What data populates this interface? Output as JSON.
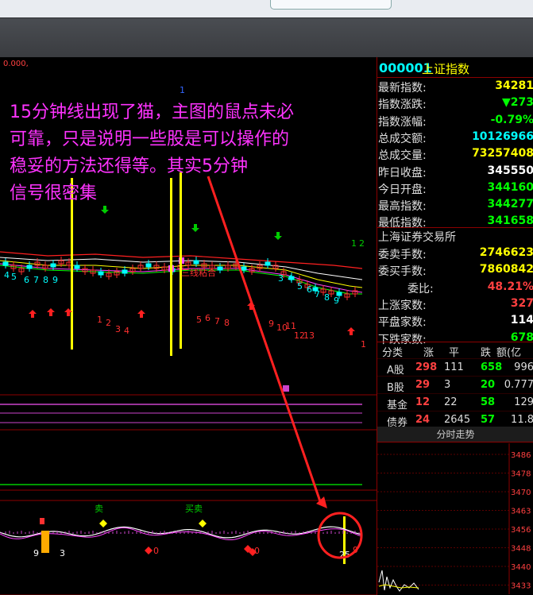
{
  "annotation": "15分钟线出现了猫，主图的鼠点未必可靠，只是说明一些股是可以操作的稳妥的方法还得等。其实5分钟信号很密集",
  "annotation_lines": [
    "15分钟线出现了猫，主图的鼠点未必",
    "可靠，只是说明一些股是可以操作的",
    "稳妥的方法还得等。其实5分钟",
    "信号很密集"
  ],
  "chart_corner_label": "0.000,",
  "quote": {
    "code": "000001",
    "name": "上证指数",
    "rows": [
      {
        "label": "最新指数:",
        "value": "34281",
        "color": "#ffff00"
      },
      {
        "label": "指数涨跌:",
        "value": "▼273",
        "color": "#00ff00"
      },
      {
        "label": "指数涨幅:",
        "value": "-0.79%",
        "color": "#00ff00"
      },
      {
        "label": "总成交额:",
        "value": "10126966",
        "color": "#00ffff"
      },
      {
        "label": "总成交量:",
        "value": "73257408",
        "color": "#ffff00"
      },
      {
        "label": "昨日收盘:",
        "value": "345550",
        "color": "#ffffff"
      },
      {
        "label": "今日开盘:",
        "value": "344160",
        "color": "#00ff00"
      },
      {
        "label": "最高指数:",
        "value": "344277",
        "color": "#00ff00"
      },
      {
        "label": "最低指数:",
        "value": "341658",
        "color": "#00ff00"
      }
    ],
    "exchange": "上海证券交易所",
    "rows2": [
      {
        "label": "委卖手数:",
        "value": "2746623",
        "color": "#ffff00"
      },
      {
        "label": "委买手数:",
        "value": "7860842",
        "color": "#ffff00"
      },
      {
        "label": "委比:",
        "value": "48.21%",
        "color": "#ff4040"
      },
      {
        "label": "上涨家数:",
        "value": "327",
        "color": "#ff4040"
      },
      {
        "label": "平盘家数:",
        "value": "114",
        "color": "#ffffff"
      },
      {
        "label": "下跌家数:",
        "value": "678",
        "color": "#00ff00"
      }
    ],
    "table_head": [
      "分类",
      "涨",
      "平",
      "跌",
      "额(亿"
    ],
    "table_rows": [
      [
        "A股",
        "298",
        "111",
        "658",
        "996"
      ],
      [
        "B股",
        "29",
        "3",
        "20",
        "0.777"
      ],
      [
        "基金",
        "12",
        "22",
        "58",
        "129"
      ],
      [
        "债券",
        "24",
        "2645",
        "57",
        "11.8"
      ]
    ],
    "panel_title": "分时走势",
    "price_ticks": [
      "3486",
      "3478",
      "3470",
      "3463",
      "3456",
      "3448",
      "3440",
      "3433"
    ]
  },
  "chart_data": {
    "type": "candlestick",
    "signals_main": {
      "up_numbers": [
        "1",
        "2",
        "3",
        "4",
        "5",
        "6",
        "7",
        "8",
        "9",
        "10",
        "11",
        "12",
        "13"
      ],
      "down_numbers": [
        "1",
        "2",
        "3",
        "4",
        "5",
        "6",
        "7",
        "8",
        "9"
      ],
      "label_sanxian": "三线粘合"
    },
    "sub_panel_labels": [
      "卖",
      "买卖",
      "买",
      "0",
      "0",
      "9",
      "3",
      "25",
      "9"
    ]
  },
  "colors": {
    "annotation": "#ff33ff",
    "yellow_line": "#ffff00",
    "arrow": "#ff2020"
  }
}
